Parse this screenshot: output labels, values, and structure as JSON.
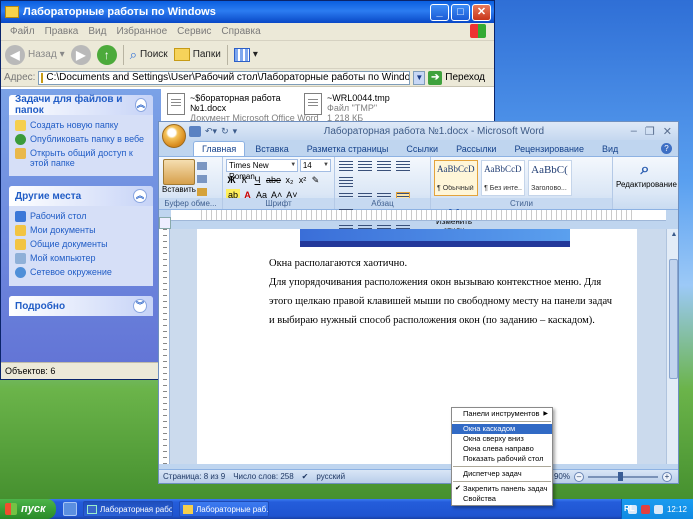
{
  "explorer": {
    "title": "Лабораторные работы по Windows",
    "menu": [
      "Файл",
      "Правка",
      "Вид",
      "Избранное",
      "Сервис",
      "Справка"
    ],
    "toolbar": {
      "back": "Назад",
      "search": "Поиск",
      "folders": "Папки"
    },
    "address": {
      "label": "Адрес:",
      "path": "C:\\Documents and Settings\\User\\Рабочий стол\\Лабораторные работы по Windows",
      "go": "Переход"
    },
    "tasks_panel": {
      "title": "Задачи для файлов и папок",
      "items": [
        "Создать новую папку",
        "Опубликовать папку в вебе",
        "Открыть общий доступ к этой папке"
      ]
    },
    "places_panel": {
      "title": "Другие места",
      "items": [
        "Рабочий стол",
        "Мои документы",
        "Общие документы",
        "Мой компьютер",
        "Сетевое окружение"
      ]
    },
    "details_panel": {
      "title": "Подробно"
    },
    "files": [
      {
        "name": "~$бораторная работа",
        "name2": "№1.docx",
        "meta": "Документ Microsoft Office Word"
      },
      {
        "name": "~WRL0044.tmp",
        "name2": "Файл \"TMP\"",
        "meta": "1 218 КБ"
      }
    ],
    "status": "Объектов: 6"
  },
  "word": {
    "title": "Лабораторная работа №1.docx - Microsoft Word",
    "tabs": [
      "Главная",
      "Вставка",
      "Разметка страницы",
      "Ссылки",
      "Рассылки",
      "Рецензирование",
      "Вид"
    ],
    "ribbon": {
      "clipboard": {
        "paste": "Вставить",
        "label": "Буфер обме..."
      },
      "font": {
        "name": "Times New Roman",
        "size": "14",
        "label": "Шрифт"
      },
      "paragraph": {
        "label": "Абзац"
      },
      "styles": {
        "label": "Стили",
        "items": [
          {
            "sample": "AaBbCcDc",
            "name": "¶ Обычный"
          },
          {
            "sample": "AaBbCcDc",
            "name": "¶ Без инте..."
          },
          {
            "sample": "AaBbC(",
            "name": "Заголово..."
          }
        ],
        "change": "Изменить стили"
      },
      "editing": {
        "label": "Редактирование"
      }
    },
    "document": {
      "paragraphs": [
        "Окна располагаются хаотично.",
        "Для упорядочивания расположения окон вызываю контекстное меню. Для этого щелкаю правой клавишей мыши по свободному месту на панели задач и выбираю нужный способ расположения окон (по заданию – каскадом)."
      ]
    },
    "status": {
      "page": "Страница: 8 из 9",
      "words": "Число слов: 258",
      "lang": "русский",
      "zoom": "90%"
    }
  },
  "context_menu": {
    "toolbars": "Панели инструментов",
    "cascade": "Окна каскадом",
    "stack": "Окна сверху вниз",
    "side": "Окна слева направо",
    "desktop": "Показать рабочий стол",
    "taskmgr": "Диспетчер задач",
    "lock": "Закрепить панель задач",
    "props": "Свойства"
  },
  "taskbar": {
    "start": "пуск",
    "buttons": [
      "Лабораторная рабо...",
      "Лабораторные раб..."
    ],
    "lang": "RL",
    "clock": "12:12"
  }
}
